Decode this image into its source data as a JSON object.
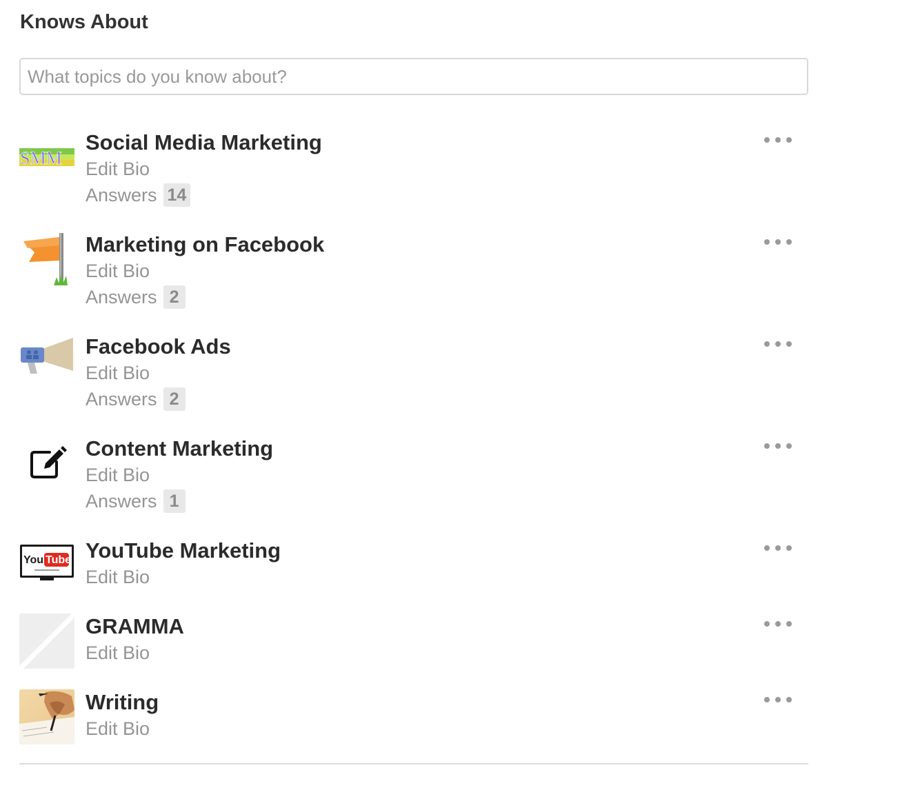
{
  "section": {
    "title": "Knows About",
    "search_placeholder": "What topics do you know about?"
  },
  "topics": [
    {
      "name": "Social Media Marketing",
      "edit_bio": "Edit Bio",
      "answers_label": "Answers",
      "answers_count": "14",
      "image_icon": "smm-logo-icon",
      "image_text": "SMM"
    },
    {
      "name": "Marketing on Facebook",
      "edit_bio": "Edit Bio",
      "answers_label": "Answers",
      "answers_count": "2",
      "image_icon": "orange-flag-icon"
    },
    {
      "name": "Facebook Ads",
      "edit_bio": "Edit Bio",
      "answers_label": "Answers",
      "answers_count": "2",
      "image_icon": "megaphone-icon"
    },
    {
      "name": "Content Marketing",
      "edit_bio": "Edit Bio",
      "answers_label": "Answers",
      "answers_count": "1",
      "image_icon": "edit-pencil-icon"
    },
    {
      "name": "YouTube Marketing",
      "edit_bio": "Edit Bio",
      "image_icon": "youtube-tv-icon",
      "image_text_you": "You",
      "image_text_tube": "Tube"
    },
    {
      "name": "GRAMMA",
      "edit_bio": "Edit Bio",
      "image_icon": "placeholder-image-icon"
    },
    {
      "name": "Writing",
      "edit_bio": "Edit Bio",
      "image_icon": "writing-hand-icon"
    }
  ],
  "colors": {
    "title": "#333333",
    "muted_text": "#949494",
    "count_badge_bg": "#e8e8e8",
    "border": "#d8d8d8",
    "flag_orange": "#f4922f",
    "youtube_red": "#e02a20"
  }
}
